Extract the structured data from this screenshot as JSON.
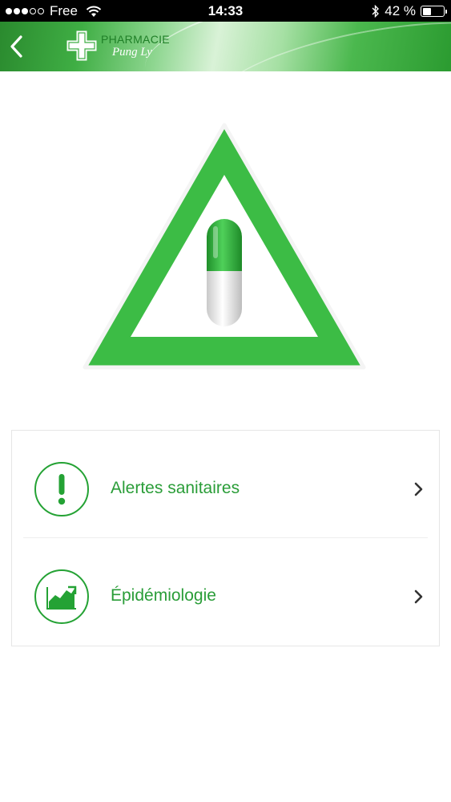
{
  "status_bar": {
    "carrier": "Free",
    "time": "14:33",
    "battery_percent": "42 %",
    "battery_level": 0.42,
    "signal_dots_filled": 3,
    "signal_dots_total": 5
  },
  "header": {
    "logo_title": "PHARMACIE",
    "logo_subtitle": "Pung Ly"
  },
  "menu": {
    "items": [
      {
        "label": "Alertes sanitaires",
        "icon": "exclamation-icon"
      },
      {
        "label": "Épidémiologie",
        "icon": "chart-icon"
      }
    ]
  },
  "colors": {
    "brand_green": "#24a234",
    "label_green": "#2a9d38"
  }
}
